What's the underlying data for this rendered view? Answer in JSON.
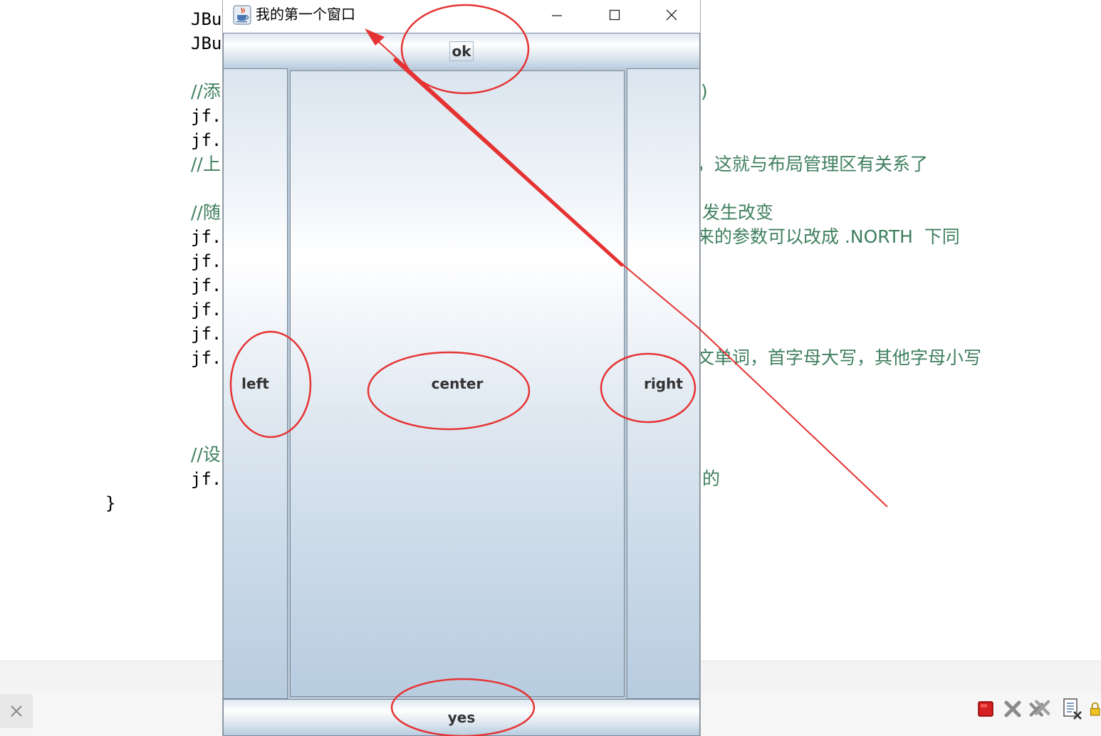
{
  "editor": {
    "code_lines": [
      "JBu",
      "JBu",
      "//添",
      "jf.",
      "jf.",
      "//上",
      "//随",
      "jf.",
      "jf.",
      "jf.",
      "jf.",
      "jf.",
      "jf.",
      "//设",
      "jf.",
      "}"
    ],
    "right_fragments": [
      ")",
      "，这就与布局管理区有关系了",
      "发生改变",
      "来的参数可以改成 .NORTH  下同",
      "文单词，首字母大写，其他字母小写",
      "的"
    ]
  },
  "window": {
    "title": "我的第一个窗口",
    "app_icon": "java-cup-icon",
    "controls": [
      "minimize-icon",
      "maximize-icon",
      "close-icon"
    ]
  },
  "layout_buttons": {
    "north": "ok",
    "west": "left",
    "center": "center",
    "east": "right",
    "south": "yes"
  },
  "annotation_color": "#e53333",
  "toolbar_icons": [
    "close-icon",
    "stop-icon",
    "remove-icon",
    "remove-all-icon",
    "clear-console-icon",
    "scroll-lock-icon"
  ]
}
